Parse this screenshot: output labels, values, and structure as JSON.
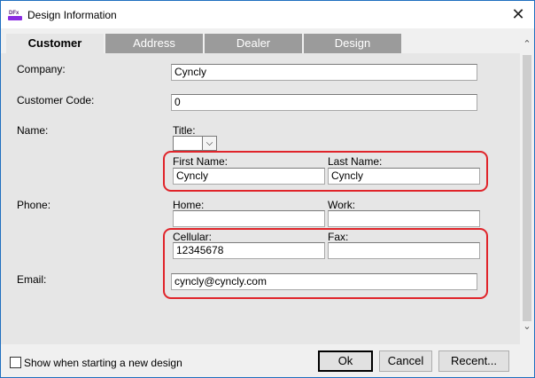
{
  "window": {
    "title": "Design Information",
    "close_glyph": "✕",
    "app_icon": "dfx-app-icon"
  },
  "tabs": [
    {
      "label": "Customer",
      "active": true
    },
    {
      "label": "Address",
      "active": false
    },
    {
      "label": "Dealer",
      "active": false
    },
    {
      "label": "Design",
      "active": false
    }
  ],
  "form": {
    "company_label": "Company:",
    "company_value": "Cyncly",
    "customer_code_label": "Customer Code:",
    "customer_code_value": "0",
    "name_label": "Name:",
    "title_label": "Title:",
    "title_value": "",
    "first_name_label": "First Name:",
    "first_name_value": "Cyncly",
    "last_name_label": "Last Name:",
    "last_name_value": "Cyncly",
    "phone_label": "Phone:",
    "home_label": "Home:",
    "home_value": "",
    "work_label": "Work:",
    "work_value": "",
    "cellular_label": "Cellular:",
    "cellular_value": "12345678",
    "fax_label": "Fax:",
    "fax_value": "",
    "email_label": "Email:",
    "email_value": "cyncly@cyncly.com"
  },
  "footer": {
    "show_label": "Show when starting a new design",
    "show_checked": false,
    "ok_label": "Ok",
    "cancel_label": "Cancel",
    "recent_label": "Recent..."
  },
  "colors": {
    "highlight": "#e0242a",
    "tab_inactive": "#9b9b9b",
    "tab_active": "#e6e6e6",
    "panel": "#e6e6e6"
  }
}
